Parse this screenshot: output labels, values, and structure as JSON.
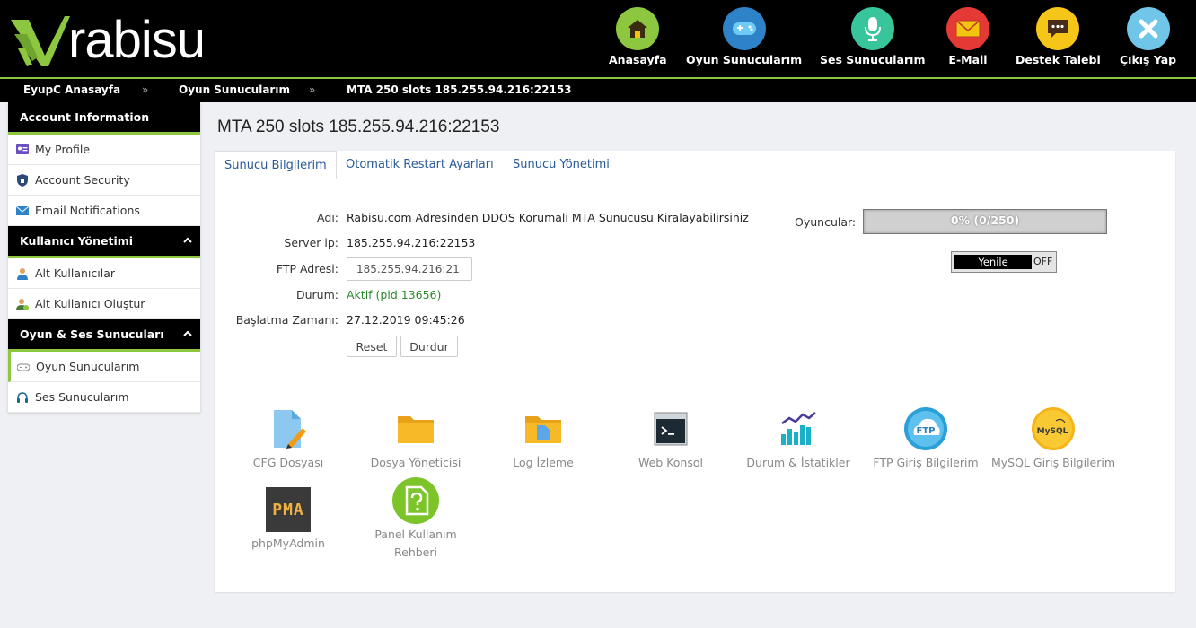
{
  "brand": {
    "logo_text": "rabisu"
  },
  "nav": [
    {
      "label": "Anasayfa",
      "icon": "home-icon",
      "color": "#8dc63f"
    },
    {
      "label": "Oyun Sunucularım",
      "icon": "gamepad-icon",
      "color": "#2d82c8"
    },
    {
      "label": "Ses Sunucularım",
      "icon": "microphone-icon",
      "color": "#39c59b"
    },
    {
      "label": "E-Mail",
      "icon": "envelope-icon",
      "color": "#e53935"
    },
    {
      "label": "Destek Talebi",
      "icon": "chat-icon",
      "color": "#f5c518"
    },
    {
      "label": "Çıkış Yap",
      "icon": "close-icon",
      "color": "#6fc6e8"
    }
  ],
  "breadcrumb": [
    "EyupC Anasayfa",
    "Oyun Sunucularım",
    "MTA 250 slots 185.255.94.216:22153"
  ],
  "breadcrumb_separator": "»",
  "sidebar": {
    "sections": [
      {
        "title": "Account Information",
        "items": [
          {
            "label": "My Profile",
            "icon": "profile-card-icon"
          },
          {
            "label": "Account Security",
            "icon": "shield-icon"
          },
          {
            "label": "Email Notifications",
            "icon": "envelope-icon"
          }
        ]
      },
      {
        "title": "Kullanıcı Yönetimi",
        "items": [
          {
            "label": "Alt Kullanıcılar",
            "icon": "user-icon"
          },
          {
            "label": "Alt Kullanıcı Oluştur",
            "icon": "user-add-icon"
          }
        ]
      },
      {
        "title": "Oyun & Ses Sunucuları",
        "items": [
          {
            "label": "Oyun Sunucularım",
            "icon": "gamepad-icon"
          },
          {
            "label": "Ses Sunucularım",
            "icon": "headset-icon"
          }
        ]
      }
    ]
  },
  "main": {
    "title": "MTA 250 slots 185.255.94.216:22153",
    "tabs": [
      "Sunucu Bilgilerim",
      "Otomatik Restart Ayarları",
      "Sunucu Yönetimi"
    ],
    "info": {
      "name_label": "Adı:",
      "name_value": "Rabisu.com Adresinden DDOS Korumali MTA Sunucusu Kiralayabilirsiniz",
      "ip_label": "Server ip:",
      "ip_value": "185.255.94.216:22153",
      "ftp_label": "FTP Adresi:",
      "ftp_value": "185.255.94.216:21",
      "status_label": "Durum:",
      "status_value": "Aktif (pid 13656)",
      "start_label": "Başlatma Zamanı:",
      "start_value": "27.12.2019 09:45:26"
    },
    "buttons": {
      "reset": "Reset",
      "stop": "Durdur"
    },
    "players": {
      "label": "Oyuncular:",
      "text": "0% (0/250)",
      "percent": 0
    },
    "refresh_toggle": {
      "on_label": "Yenile",
      "off_label": "OFF"
    },
    "tools": [
      {
        "label": "CFG Dosyası",
        "icon": "cfg-file-icon"
      },
      {
        "label": "Dosya Yöneticisi",
        "icon": "folder-icon"
      },
      {
        "label": "Log İzleme",
        "icon": "log-folder-icon"
      },
      {
        "label": "Web Konsol",
        "icon": "terminal-icon"
      },
      {
        "label": "Durum & İstatikler",
        "icon": "stats-chart-icon"
      },
      {
        "label": "FTP Giriş Bilgilerim",
        "icon": "ftp-cloud-icon"
      },
      {
        "label": "MySQL Giriş Bilgilerim",
        "icon": "mysql-icon"
      },
      {
        "label": "phpMyAdmin",
        "icon": "pma-icon",
        "icon_text": "PMA"
      },
      {
        "label": "Panel Kullanım Rehberi",
        "icon": "help-document-icon"
      }
    ]
  }
}
